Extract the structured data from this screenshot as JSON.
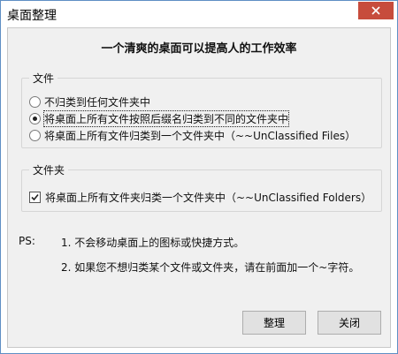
{
  "window": {
    "title": "桌面整理",
    "close_glyph": "✕"
  },
  "heading": "一个清爽的桌面可以提高人的工作效率",
  "files_group": {
    "label": "文件",
    "options": [
      {
        "label": "不归类到任何文件夹中",
        "selected": false
      },
      {
        "label": "将桌面上所有文件按照后缀名归类到不同的文件夹中",
        "selected": true
      },
      {
        "label": "将桌面上所有文件归类到一个文件夹中（~~UnClassified Files）",
        "selected": false
      }
    ]
  },
  "folders_group": {
    "label": "文件夹",
    "option": {
      "label": "将桌面上所有文件夹归类一个文件夹中（~~UnClassified Folders）",
      "checked": true
    }
  },
  "ps": {
    "label": "PS:",
    "notes": [
      "1. 不会移动桌面上的图标或快捷方式。",
      "2. 如果您不想归类某个文件或文件夹，请在前面加一个~字符。"
    ]
  },
  "buttons": {
    "organize": "整理",
    "close": "关闭"
  },
  "colors": {
    "close_button": "#c74c3c",
    "window_border": "#5f8fc4",
    "client_bg": "#f0f0f0"
  }
}
